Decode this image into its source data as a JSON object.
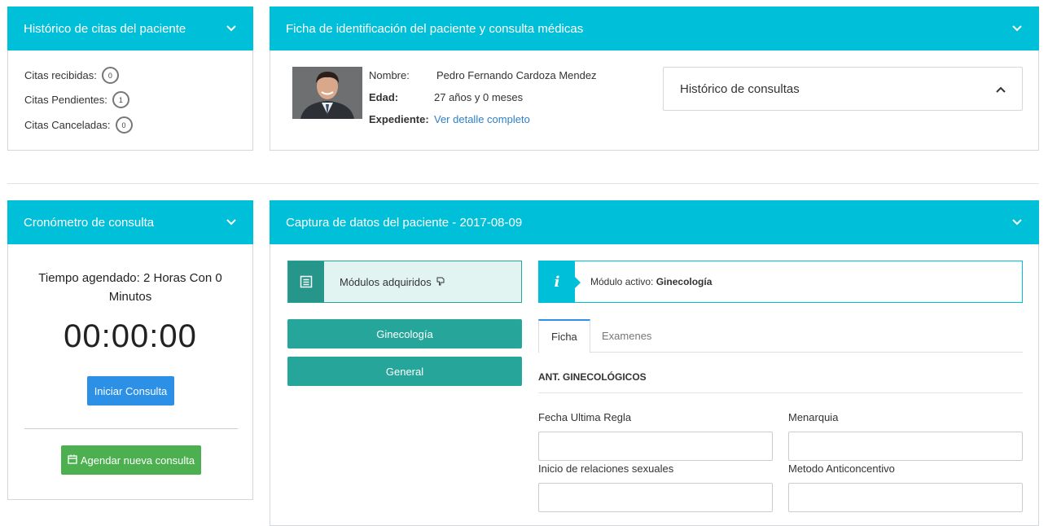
{
  "historico": {
    "title": "Histórico de citas del paciente",
    "stats": [
      {
        "label": "Citas recibidas:",
        "count": "0"
      },
      {
        "label": "Citas Pendientes:",
        "count": "1"
      },
      {
        "label": "Citas Canceladas:",
        "count": "0"
      }
    ]
  },
  "ficha": {
    "title": "Ficha de identificación del paciente y consulta médicas",
    "nombre_label": "Nombre:",
    "nombre_value": "Pedro Fernando Cardoza Mendez",
    "edad_label": "Edad:",
    "edad_value": "27 años y 0 meses",
    "expediente_label": "Expediente:",
    "expediente_link": "Ver detalle completo",
    "historico_consultas": "Histórico de consultas"
  },
  "cronometro": {
    "title": "Cronómetro de consulta",
    "tiempo_agendado": "Tiempo agendado: 2 Horas Con 0 Minutos",
    "timer": "00:00:00",
    "iniciar_label": "Iniciar Consulta",
    "agendar_label": "Agendar nueva consulta"
  },
  "captura": {
    "title": "Captura de datos del paciente - 2017-08-09",
    "modulos_label": "Módulos adquiridos",
    "modulos": [
      "Ginecología",
      "General"
    ],
    "activo_prefix": "Módulo activo:",
    "activo_value": "Ginecología",
    "tabs": [
      "Ficha",
      "Examenes"
    ],
    "section": "ANT. GINECOLÓGICOS",
    "fields": [
      {
        "label": "Fecha Ultima Regla",
        "value": ""
      },
      {
        "label": "Menarquia",
        "value": ""
      },
      {
        "label": "Inicio de relaciones sexuales",
        "value": ""
      },
      {
        "label": "Metodo Anticoncentivo",
        "value": ""
      }
    ]
  },
  "colors": {
    "header": "#00c0d9",
    "teal": "#26a69a",
    "blue": "#2b90e6",
    "green": "#4caf50"
  }
}
